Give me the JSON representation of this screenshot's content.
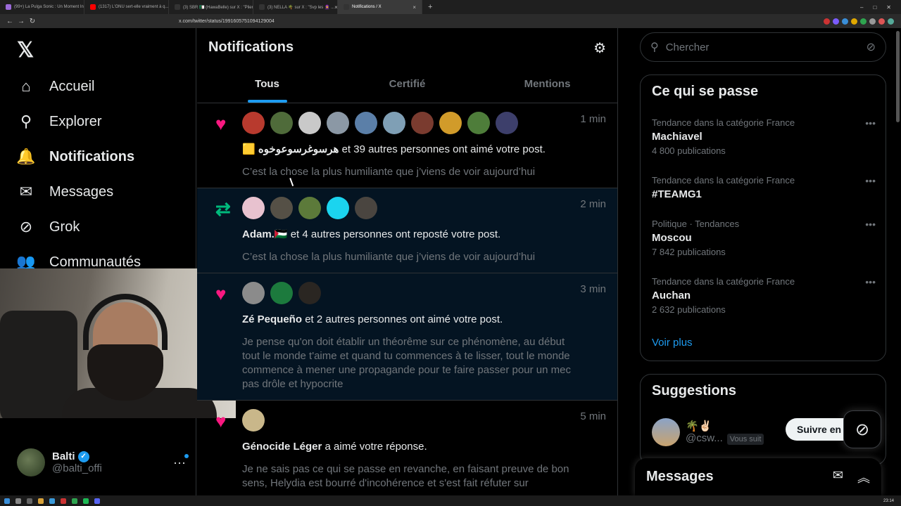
{
  "browser": {
    "tabs": [
      {
        "label": "(99+) La Pulga Sonic : Un Moment In...",
        "color": "#9b6ad9",
        "active": false
      },
      {
        "label": "(1317) L'ONU sert-elle vraiment à q...",
        "color": "#ff0000",
        "active": false
      },
      {
        "label": "(3) SBR 🇩🇿 (HawaBelle) sur X : \"Plier...",
        "color": "#333333",
        "active": false
      },
      {
        "label": "(3) NELLA 🌴 sur X : \"Svp les 🧕 ...",
        "color": "#333333",
        "active": false
      },
      {
        "label": "Notifications / X",
        "color": "#333333",
        "active": true
      }
    ],
    "new_tab": "+",
    "url": "x.com/twitter/status/1991605751094129004"
  },
  "left_nav": {
    "logo": "𝕏",
    "items": [
      {
        "label": "Accueil",
        "icon": "home-icon",
        "glyph": "⌂",
        "active": false
      },
      {
        "label": "Explorer",
        "icon": "search-icon",
        "glyph": "⚲",
        "active": false
      },
      {
        "label": "Notifications",
        "icon": "bell-icon",
        "glyph": "🔔",
        "active": true
      },
      {
        "label": "Messages",
        "icon": "mail-icon",
        "glyph": "✉",
        "active": false
      },
      {
        "label": "Grok",
        "icon": "grok-icon",
        "glyph": "⊘",
        "active": false
      },
      {
        "label": "Communautés",
        "icon": "communities-icon",
        "glyph": "👥",
        "active": false
      }
    ],
    "profile": {
      "name": "Balti",
      "handle": "@balti_offi",
      "more": "···"
    }
  },
  "main": {
    "title": "Notifications",
    "tabs": [
      "Tous",
      "Certifié",
      "Mentions"
    ],
    "notifications": [
      {
        "type": "like",
        "time": "1 min",
        "avatar_colors": [
          "#b83a2e",
          "#4f6b3a",
          "#c9c9c9",
          "#8b98a5",
          "#5b7fa8",
          "#7f9fb5",
          "#7a3b2f",
          "#d19b2a",
          "#4e7d3a",
          "#3d3f6b"
        ],
        "actor": "🟨 هرسوغرسوعوخوه",
        "text": "et 39 autres personnes ont aimé votre post.",
        "quote": "C’est la chose la plus humiliante que j’viens de voir aujourd’hui"
      },
      {
        "type": "repost",
        "time": "2 min",
        "avatar_colors": [
          "#e8c2cf",
          "#555046",
          "#5c7a3a",
          "#1bd4ef",
          "#4a4540"
        ],
        "actor": "Adam.🇵🇸",
        "text": "et 4 autres personnes ont reposté votre post.",
        "quote": "C’est la chose la plus humiliante que j’viens de voir aujourd’hui"
      },
      {
        "type": "like",
        "time": "3 min",
        "avatar_colors": [
          "#8b8b8b",
          "#1c7a3d",
          "#2a2622"
        ],
        "actor": "Zé Pequeño",
        "text": "et 2 autres personnes ont aimé votre post.",
        "quote": "Je pense qu'on doit établir un théorême sur ce phénomène, au début tout le monde t'aime et quand tu commences à te lisser, tout le monde commence à mener une propagande pour te faire passer pour un mec pas drôle et hypocrite"
      },
      {
        "type": "like",
        "time": "5 min",
        "avatar_colors": [
          "#c9b78a"
        ],
        "actor": "Génocide Léger",
        "text": "a aimé votre réponse.",
        "quote": "Je ne sais pas ce qui se passe en revanche, en faisant preuve de bon sens, Helydia est bourré d'incohérence et s'est fait réfuter sur"
      }
    ]
  },
  "right": {
    "search_placeholder": "Chercher",
    "trends_title": "Ce qui se passe",
    "trends": [
      {
        "meta": "Tendance dans la catégorie France",
        "name": "Machiavel",
        "count": "4 800 publications"
      },
      {
        "meta": "Tendance dans la catégorie France",
        "name": "#TEAMG1",
        "count": ""
      },
      {
        "meta": "Politique · Tendances",
        "name": "Moscou",
        "count": "7 842 publications"
      },
      {
        "meta": "Tendance dans la catégorie France",
        "name": "Auchan",
        "count": "2 632 publications"
      }
    ],
    "see_more": "Voir plus",
    "suggestions_title": "Suggestions",
    "suggestion": {
      "emoji": "🌴✌🏻",
      "handle": "@csw...",
      "follows_you": "Vous suit",
      "follow_label": "Suivre en re"
    },
    "messages_title": "Messages"
  },
  "taskbar": {
    "time": "23:14"
  }
}
